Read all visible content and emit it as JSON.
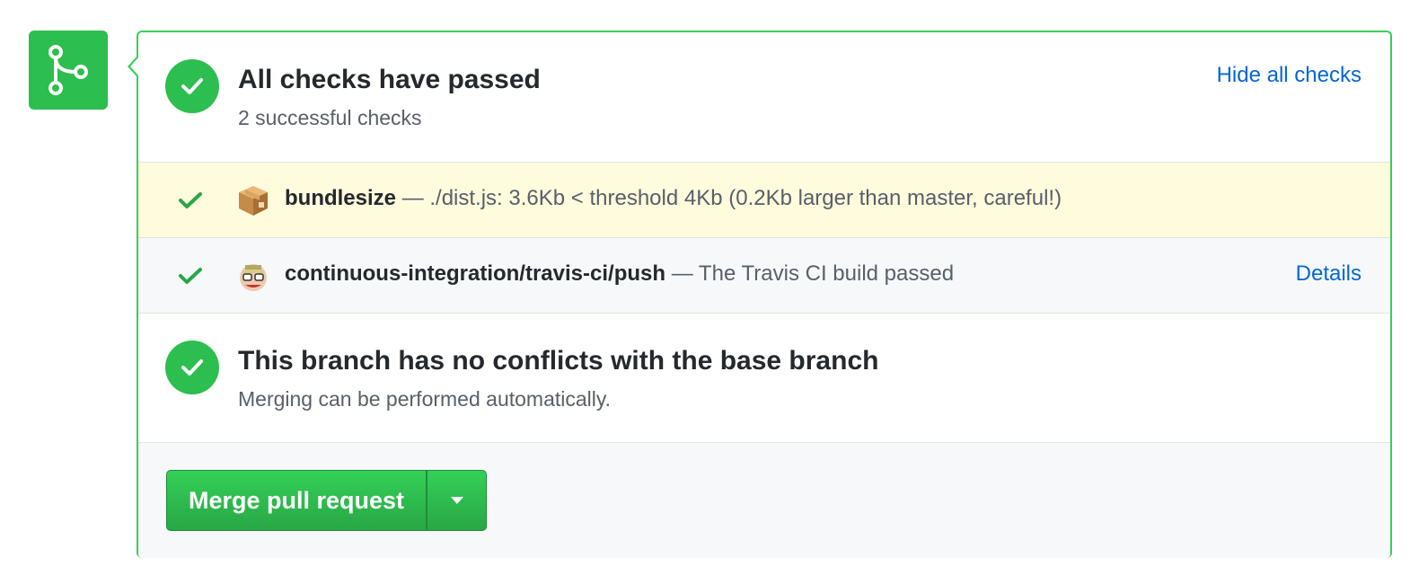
{
  "status": {
    "title": "All checks have passed",
    "subtitle": "2 successful checks",
    "toggle_link": "Hide all checks"
  },
  "checks": [
    {
      "avatar": "package-box-icon",
      "context": "bundlesize",
      "description": " — ./dist.js: 3.6Kb < threshold 4Kb (0.2Kb larger than master, careful!)",
      "details_link": ""
    },
    {
      "avatar": "travis-ci-mascot-icon",
      "context": "continuous-integration/travis-ci/push",
      "description": " — The Travis CI build passed",
      "details_link": "Details"
    }
  ],
  "conflicts": {
    "title": "This branch has no conflicts with the base branch",
    "subtitle": "Merging can be performed automatically."
  },
  "merge": {
    "button_label": "Merge pull request"
  },
  "colors": {
    "success": "#2cbe4e",
    "link": "#0366d6",
    "pending_highlight": "#fffbdd"
  }
}
